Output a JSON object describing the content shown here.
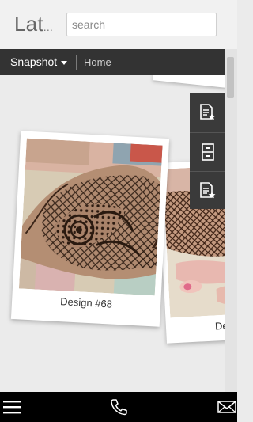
{
  "header": {
    "brand": "Lat",
    "brand_ellipsis": "...",
    "search_placeholder": "search"
  },
  "nav": {
    "dropdown_label": "Snapshot",
    "breadcrumb_home": "Home"
  },
  "tools": [
    {
      "icon": "document-star-icon"
    },
    {
      "icon": "file-cabinet-icon"
    },
    {
      "icon": "document-star-icon"
    }
  ],
  "cards": [
    {
      "caption": "Design #68"
    },
    {
      "caption": "De"
    }
  ],
  "bottom_bar": {
    "icons": [
      "menu-icon",
      "phone-icon",
      "mail-icon"
    ]
  },
  "colors": {
    "navbar": "#333333",
    "bottom_bar": "#000000",
    "tool_panel": "#3a3a3a"
  }
}
